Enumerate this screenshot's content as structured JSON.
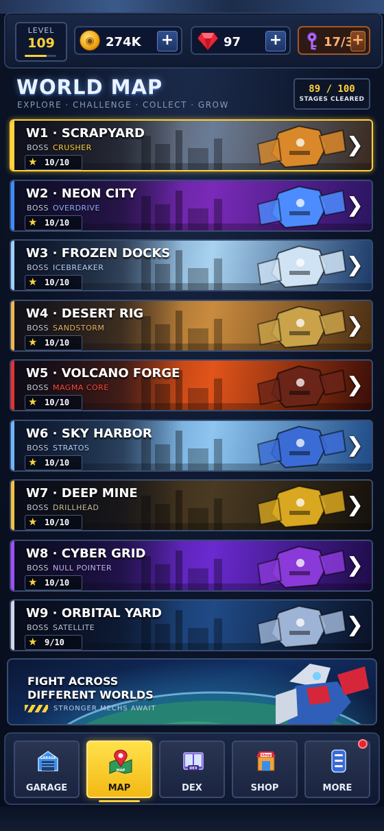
{
  "topbar": {
    "level_label": "LEVEL",
    "level_value": "109",
    "level_progress": 0.7,
    "coins": "274K",
    "gems": "97",
    "keys": "17/3",
    "plus": "+"
  },
  "header": {
    "title": "WORLD MAP",
    "subtitle": "EXPLORE · CHALLENGE · COLLECT · GROW",
    "stages_count": "89 / 100",
    "stages_label": "STAGES CLEARED"
  },
  "worlds": [
    {
      "name": "W1 · SCRAPYARD",
      "boss_label": "BOSS",
      "boss": "CRUSHER",
      "boss_color": "#ffd23a",
      "stars": "10/10",
      "accent": "#ffd23a",
      "bg1": "#3a2a20",
      "bg2": "#6a7c96",
      "mech": "#d9882a"
    },
    {
      "name": "W2 · NEON CITY",
      "boss_label": "BOSS",
      "boss": "OVERDRIVE",
      "boss_color": "#8fb6ff",
      "stars": "10/10",
      "accent": "#3d8cff",
      "bg1": "#2a1560",
      "bg2": "#7a2ab8",
      "mech": "#4d8cff"
    },
    {
      "name": "W3 · FROZEN DOCKS",
      "boss_label": "BOSS",
      "boss": "ICEBREAKER",
      "boss_color": "#b9d6ff",
      "stars": "10/10",
      "accent": "#9ed0ff",
      "bg1": "#1c3a68",
      "bg2": "#a8d2f0",
      "mech": "#cfe3f5"
    },
    {
      "name": "W4 · DESERT RIG",
      "boss_label": "BOSS",
      "boss": "SANDSTORM",
      "boss_color": "#e7b866",
      "stars": "10/10",
      "accent": "#f2b64a",
      "bg1": "#4a2e14",
      "bg2": "#c98b3e",
      "mech": "#c9a24a"
    },
    {
      "name": "W5 · VOLCANO FORGE",
      "boss_label": "BOSS",
      "boss": "MAGMA CORE",
      "boss_color": "#ff4a3a",
      "stars": "10/10",
      "accent": "#e8302c",
      "bg1": "#3a0e08",
      "bg2": "#e2541a",
      "mech": "#6a2418"
    },
    {
      "name": "W6 · SKY HARBOR",
      "boss_label": "BOSS",
      "boss": "STRATOS",
      "boss_color": "#b9d6ff",
      "stars": "10/10",
      "accent": "#6db6ff",
      "bg1": "#1f4a86",
      "bg2": "#8ec6f0",
      "mech": "#3b6cd6"
    },
    {
      "name": "W7 · DEEP MINE",
      "boss_label": "BOSS",
      "boss": "DRILLHEAD",
      "boss_color": "#c9c0a0",
      "stars": "10/10",
      "accent": "#f2c23a",
      "bg1": "#15110c",
      "bg2": "#4a3a22",
      "mech": "#d9a820"
    },
    {
      "name": "W8 · CYBER GRID",
      "boss_label": "BOSS",
      "boss": "NULL POINTER",
      "boss_color": "#c9b6ff",
      "stars": "10/10",
      "accent": "#a14dff",
      "bg1": "#1e0c48",
      "bg2": "#6a2ad0",
      "mech": "#8a3ad8"
    },
    {
      "name": "W9 · ORBITAL YARD",
      "boss_label": "BOSS",
      "boss": "SATELLITE",
      "boss_color": "#b9c6de",
      "stars": "9/10",
      "accent": "#cfd8ea",
      "bg1": "#0a1226",
      "bg2": "#1f4a86",
      "mech": "#9eb4d6"
    }
  ],
  "banner": {
    "line1": "FIGHT ACROSS",
    "line2": "DIFFERENT WORLDS",
    "tag": "STRONGER MECHS AWAIT"
  },
  "nav": {
    "tabs": [
      {
        "label": "GARAGE",
        "icon": "garage-icon",
        "icon_text": "GARAGE"
      },
      {
        "label": "MAP",
        "icon": "map-pin-icon",
        "icon_text": "MAP"
      },
      {
        "label": "DEX",
        "icon": "book-icon",
        "icon_text": "DEX"
      },
      {
        "label": "SHOP",
        "icon": "shop-icon",
        "icon_text": "Shop"
      },
      {
        "label": "MORE",
        "icon": "more-icon",
        "icon_text": ""
      }
    ],
    "active": "MAP"
  }
}
